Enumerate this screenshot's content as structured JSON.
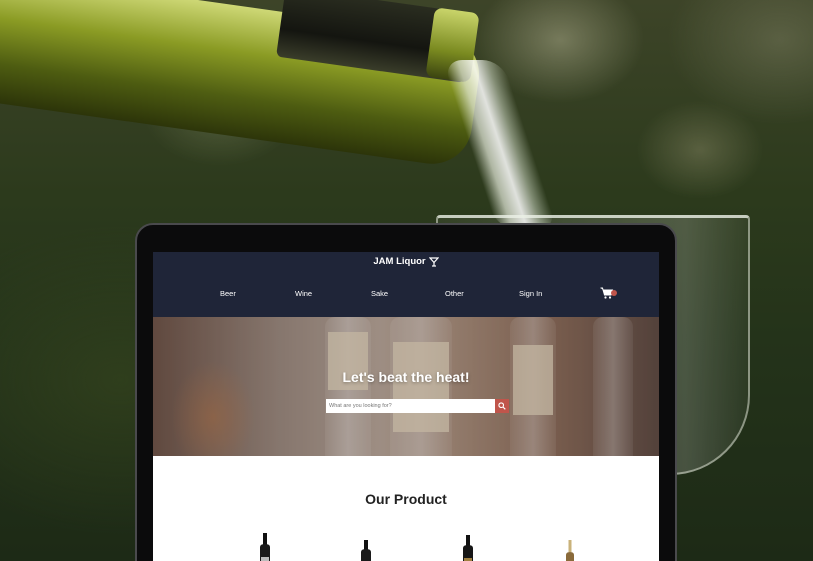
{
  "site": {
    "logo_text": "JAM Liquor",
    "nav": [
      {
        "label": "Beer"
      },
      {
        "label": "Wine"
      },
      {
        "label": "Sake"
      },
      {
        "label": "Other"
      },
      {
        "label": "Sign In"
      }
    ],
    "hero": {
      "title": "Let's beat the heat!",
      "search_placeholder": "What are you looking for?"
    },
    "products_section": {
      "title": "Our Product"
    },
    "colors": {
      "header_bg": "#1f2538",
      "accent": "#c0554b"
    },
    "icons": [
      "cocktail-glass-icon",
      "cart-icon",
      "search-icon"
    ]
  }
}
